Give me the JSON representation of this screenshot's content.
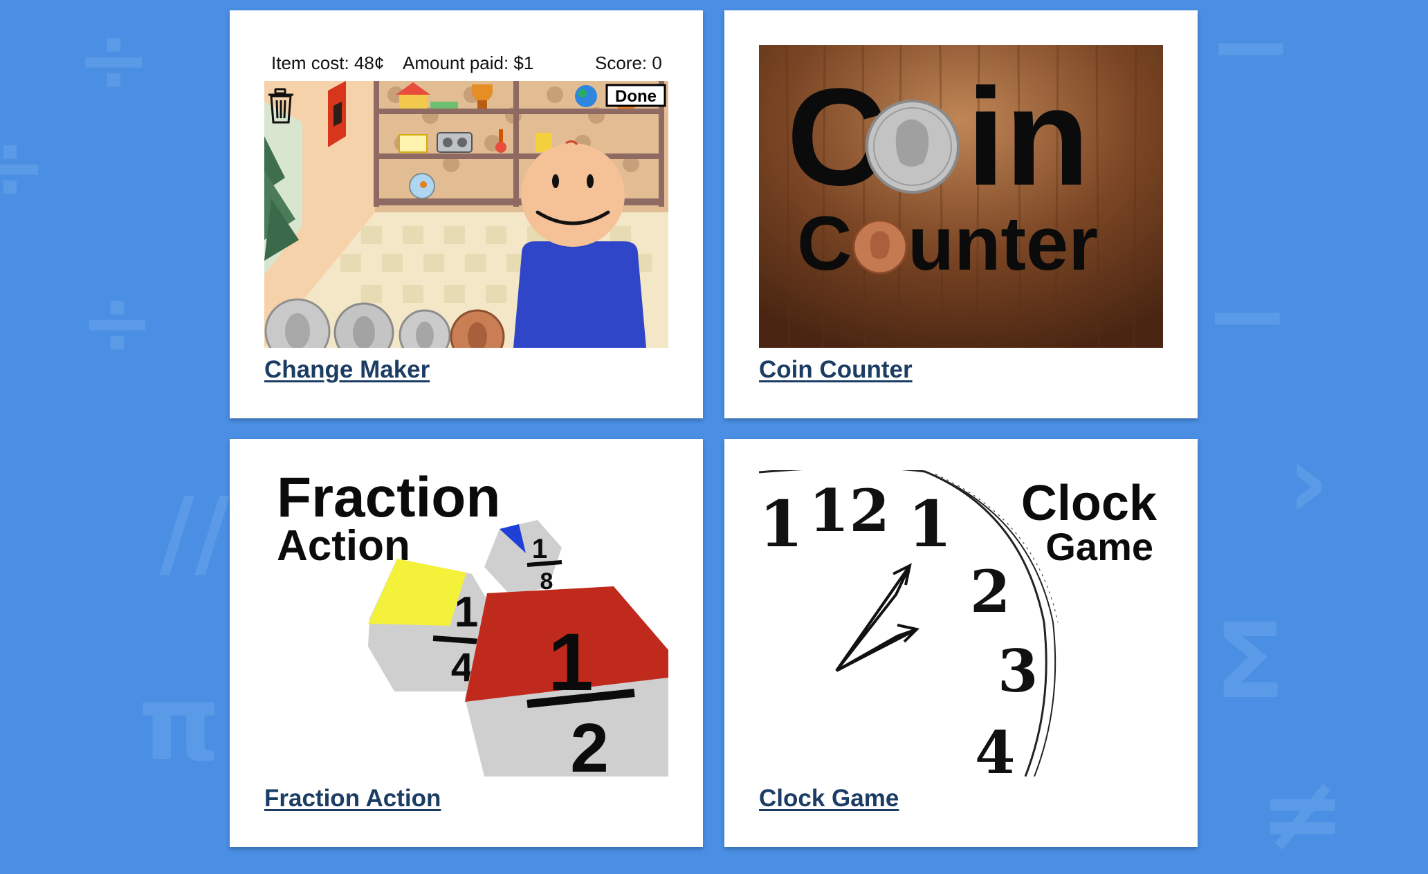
{
  "background": {
    "color": "#4a8fe4",
    "symbol_color": "#5a9ae6",
    "symbols": [
      "÷",
      "÷",
      "÷",
      "//",
      "π",
      "−",
      "−",
      "›",
      "Σ",
      "≠"
    ]
  },
  "cards": [
    {
      "link_text": "Change Maker",
      "preview": {
        "item_cost": "Item cost: 48¢",
        "amount_paid": "Amount paid: $1",
        "score": "Score: 0",
        "done_label": "Done"
      }
    },
    {
      "link_text": "Coin Counter",
      "preview": {
        "word_coin_c": "C",
        "word_coin_in": "in",
        "word_counter_c": "C",
        "word_counter_unter": "unter"
      }
    },
    {
      "link_text": "Fraction Action",
      "preview": {
        "title_line1": "Fraction",
        "title_line2": "Action",
        "quarter_num": "1",
        "quarter_den": "4",
        "eighth_num": "1",
        "eighth_den": "8",
        "half_num": "1",
        "half_den": "2"
      }
    },
    {
      "link_text": "Clock Game",
      "preview": {
        "title_line1": "Clock",
        "title_line2": "Game",
        "numerals": [
          "1",
          "12",
          "1",
          "2",
          "3",
          "4"
        ]
      }
    }
  ],
  "colors": {
    "link": "#1c3d63",
    "shirt": "#3046c9",
    "face": "#f5c196",
    "wood": "#6e3e1f",
    "fraction_yellow": "#f4f13b",
    "fraction_red": "#c02a1c",
    "fraction_blue": "#1f3fd6",
    "fraction_gray": "#cfcfcf"
  }
}
